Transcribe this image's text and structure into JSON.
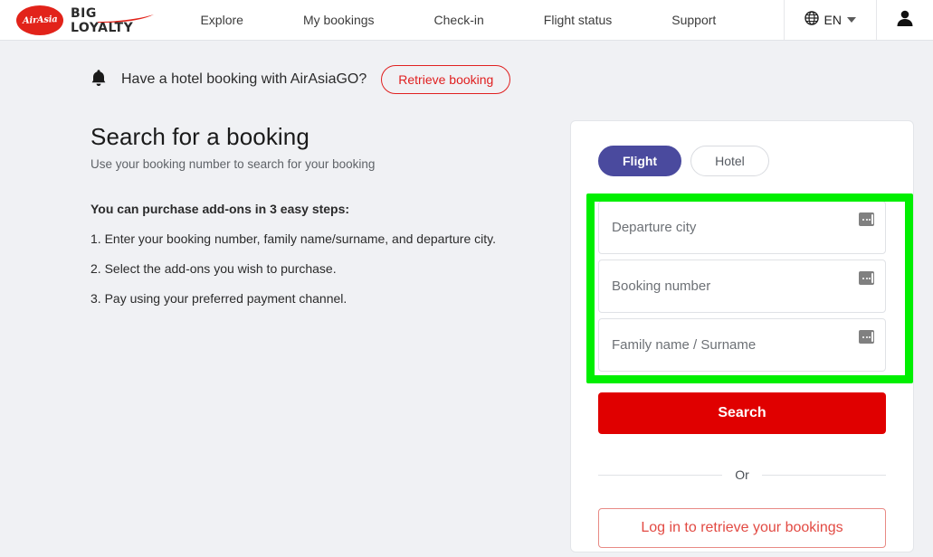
{
  "header": {
    "logo": {
      "badge_text": "AirAsia",
      "line1": "BIG",
      "line2": "LOYALTY"
    },
    "nav_items": [
      {
        "label": "Explore"
      },
      {
        "label": "My bookings"
      },
      {
        "label": "Check-in"
      },
      {
        "label": "Flight status"
      },
      {
        "label": "Support"
      }
    ],
    "language": {
      "icon": "globe-icon",
      "label": "EN",
      "caret": "chevron-down-icon"
    },
    "account_icon": "user-account-icon"
  },
  "notice": {
    "icon": "bell-icon",
    "text": "Have a hotel booking with AirAsiaGO?",
    "button_label": "Retrieve booking"
  },
  "left": {
    "title": "Search for a booking",
    "subtitle": "Use your booking number to search for your booking",
    "steps_heading": "You can purchase add-ons in 3 easy steps:",
    "steps": [
      "1. Enter your booking number, family name/surname, and departure city.",
      "2. Select the add-ons you wish to purchase.",
      "3. Pay using your preferred payment channel."
    ]
  },
  "card": {
    "tabs": [
      {
        "label": "Flight",
        "active": true
      },
      {
        "label": "Hotel",
        "active": false
      }
    ],
    "fields": [
      {
        "name": "departure-city",
        "placeholder": "Departure city",
        "value": ""
      },
      {
        "name": "booking-number",
        "placeholder": "Booking number",
        "value": ""
      },
      {
        "name": "family-name",
        "placeholder": "Family name / Surname",
        "value": ""
      }
    ],
    "search_button_label": "Search",
    "divider_label": "Or",
    "login_button_label": "Log in to retrieve your bookings"
  },
  "colors": {
    "brand_red": "#e00000",
    "logo_red": "#e2231a",
    "tab_active": "#4a4a9e",
    "highlight_green": "#00ef00",
    "page_background": "#f0f1f4",
    "link_red": "#e24a43"
  }
}
